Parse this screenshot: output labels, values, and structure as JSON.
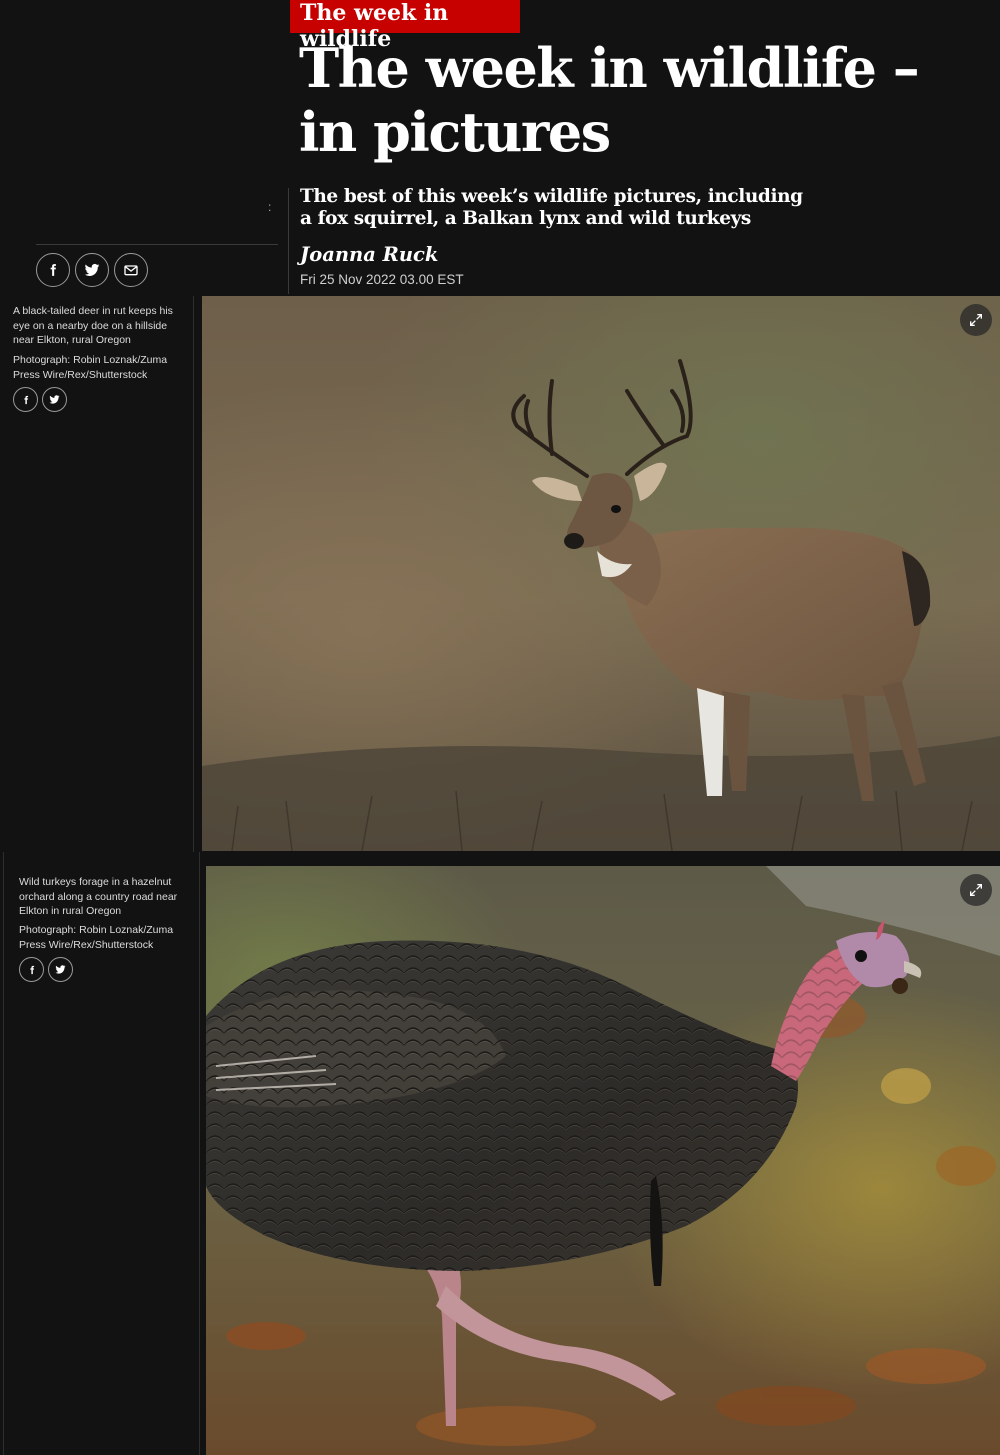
{
  "header": {
    "kicker": "The week in wildlife",
    "headline": "The week in wildlife – in pictures",
    "standfirst": "The best of this week’s wildlife pictures, including a fox squirrel, a Balkan lynx and wild turkeys",
    "byline": "Joanna Ruck",
    "dateline": "Fri 25 Nov 2022 03.00 EST",
    "menu_glyph": ":"
  },
  "share": {
    "facebook": "facebook-icon",
    "twitter": "twitter-icon",
    "email": "email-icon"
  },
  "gallery": [
    {
      "caption": "A black-tailed deer in rut keeps his eye on a nearby doe on a hillside near Elkton, rural Oregon",
      "credit": "Photograph: Robin Loznak/Zuma Press Wire/Rex/Shutterstock"
    },
    {
      "caption": "Wild turkeys forage in a hazelnut orchard along a country road near Elkton in rural Oregon",
      "credit": "Photograph: Robin Loznak/Zuma Press Wire/Rex/Shutterstock"
    }
  ],
  "colors": {
    "background": "#121212",
    "kicker_red": "#c70000",
    "text": "#ffffff"
  }
}
